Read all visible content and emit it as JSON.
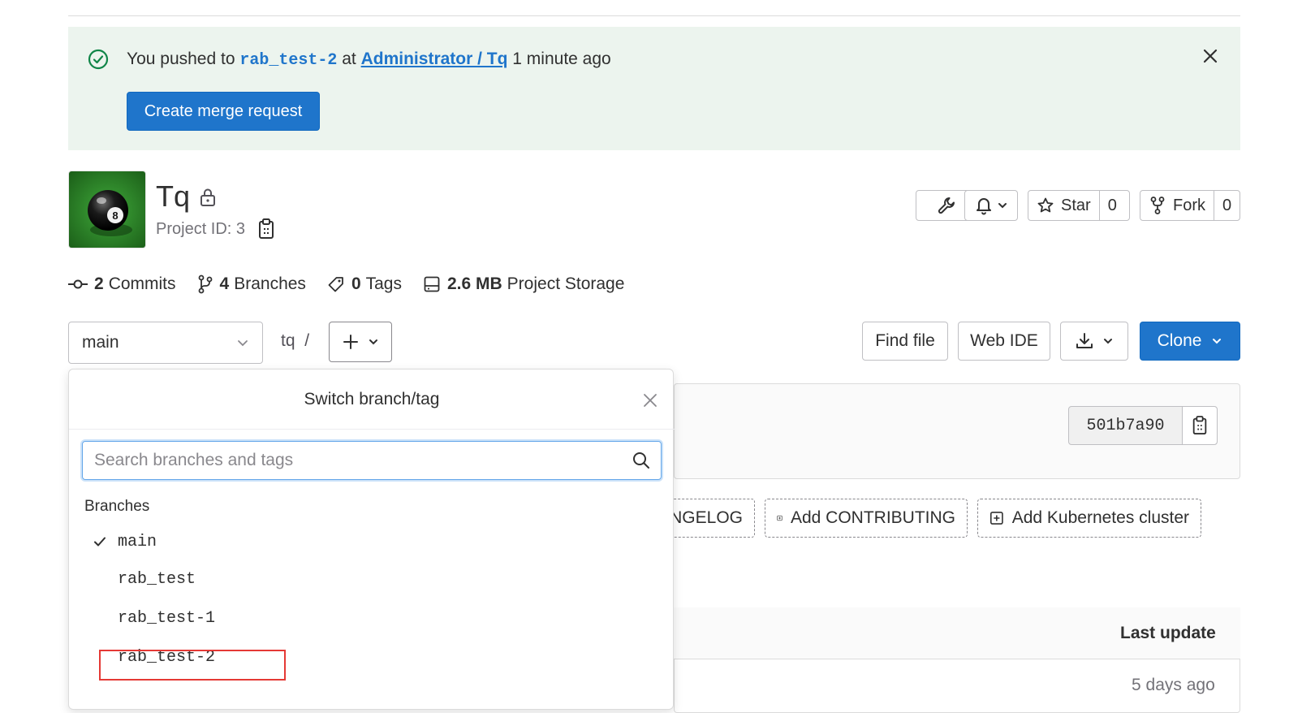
{
  "alert": {
    "prefix": "You pushed to",
    "branch": "rab_test-2",
    "at": "at",
    "project_link": "Administrator / Tq",
    "time": "1 minute ago",
    "create_mr_label": "Create merge request"
  },
  "project": {
    "name": "Tq",
    "id_label": "Project ID: 3"
  },
  "header_buttons": {
    "star_label": "Star",
    "star_count": "0",
    "fork_label": "Fork",
    "fork_count": "0"
  },
  "stats": {
    "commits_count": "2",
    "commits_label": "Commits",
    "branches_count": "4",
    "branches_label": "Branches",
    "tags_count": "0",
    "tags_label": "Tags",
    "storage_size": "2.6 MB",
    "storage_label": "Project Storage"
  },
  "repo_nav": {
    "current_branch": "main",
    "path": "tq",
    "separator": "/",
    "find_file_label": "Find file",
    "web_ide_label": "Web IDE",
    "clone_label": "Clone"
  },
  "commit": {
    "sha": "501b7a90"
  },
  "quick_actions": [
    {
      "label": "NGELOG"
    },
    {
      "label": "Add CONTRIBUTING"
    },
    {
      "label": "Add Kubernetes cluster"
    }
  ],
  "files_table": {
    "last_update_header": "Last update",
    "row_time": "5 days ago"
  },
  "dropdown": {
    "title": "Switch branch/tag",
    "search_placeholder": "Search branches and tags",
    "section_label": "Branches",
    "branches": [
      {
        "name": "main",
        "selected": true
      },
      {
        "name": "rab_test",
        "selected": false
      },
      {
        "name": "rab_test-1",
        "selected": false
      },
      {
        "name": "rab_test-2",
        "selected": false
      }
    ]
  },
  "colors": {
    "accent": "#1f75cb",
    "alert_bg": "#ecf4ee",
    "success": "#108548",
    "highlight": "#e53935"
  }
}
